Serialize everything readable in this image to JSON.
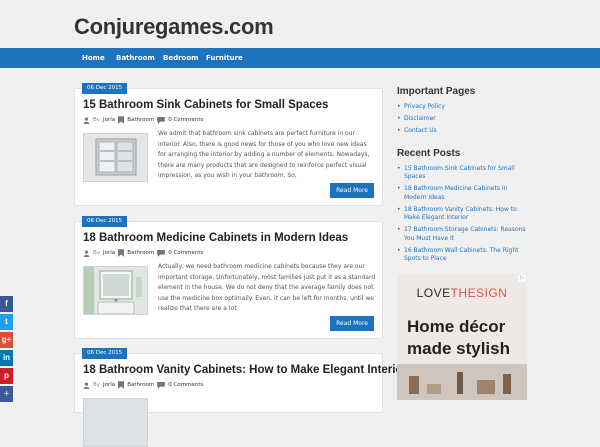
{
  "site": {
    "title": "Conjuregames.com"
  },
  "nav": [
    {
      "label": "Home"
    },
    {
      "label": "Bathroom"
    },
    {
      "label": "Bedroom"
    },
    {
      "label": "Furniture"
    }
  ],
  "posts": [
    {
      "date": "06 Dec 2015",
      "title": "15 Bathroom Sink Cabinets for Small Spaces",
      "author_prefix": "By",
      "author": "Jorla",
      "category": "Bathroom",
      "comments": "0 Comments",
      "excerpt": "We admit that bathroom sink cabinets are perfect furniture in our interior. Also, there is good news for those of you who love new ideas for arranging the interior by adding a number of elements. Nowadays, there are many products that are designed to reinforce perfect visual impression, as you wish in your bathroom. So,",
      "more_label": "Read More"
    },
    {
      "date": "06 Dec 2015",
      "title": "18 Bathroom Medicine Cabinets in Modern Ideas",
      "author_prefix": "By",
      "author": "Jorla",
      "category": "Bathroom",
      "comments": "0 Comments",
      "excerpt": "Actually, we need bathroom medicine cabinets because they are our important storage. Unfortunately, most families just put it as a standard element in the house. We do not deny that the average family does not use the medicine box optimally. Even, it can be left for months, until we realize that there are a lot",
      "more_label": "Read More"
    },
    {
      "date": "06 Dec 2015",
      "title": "18 Bathroom Vanity Cabinets: How to Make Elegant Interior",
      "author_prefix": "By",
      "author": "Jorla",
      "category": "Bathroom",
      "comments": "0 Comments",
      "excerpt": "",
      "more_label": ""
    }
  ],
  "sidebar": {
    "important": {
      "title": "Important Pages",
      "items": [
        "Privacy Policy",
        "Disclaimer",
        "Contact Us"
      ]
    },
    "recent": {
      "title": "Recent Posts",
      "items": [
        "15 Bathroom Sink Cabinets for Small Spaces",
        "18 Bathroom Medicine Cabinets in Modern Ideas",
        "18 Bathroom Vanity Cabinets: How to Make Elegant Interior",
        "17 Bathroom Storage Cabinets: Reasons You Must Have It",
        "16 Bathroom Wall Cabinets: The Right Spots to Place"
      ]
    }
  },
  "ad": {
    "brand_start": "LOVE",
    "brand_accent": "THESIGN",
    "headline_line1": "Home décor",
    "headline_line2": "made stylish",
    "adchoice": "▷"
  },
  "social": [
    {
      "icon": "facebook-icon",
      "label": "f",
      "color": "#3b5998"
    },
    {
      "icon": "twitter-icon",
      "label": "t",
      "color": "#1da1f2"
    },
    {
      "icon": "google-plus-icon",
      "label": "g+",
      "color": "#dd4b39"
    },
    {
      "icon": "linkedin-icon",
      "label": "in",
      "color": "#0077b5"
    },
    {
      "icon": "pinterest-icon",
      "label": "p",
      "color": "#cb2027"
    },
    {
      "icon": "share-icon",
      "label": "+",
      "color": "#3b5998"
    }
  ],
  "colors": {
    "accent": "#1e73be"
  }
}
